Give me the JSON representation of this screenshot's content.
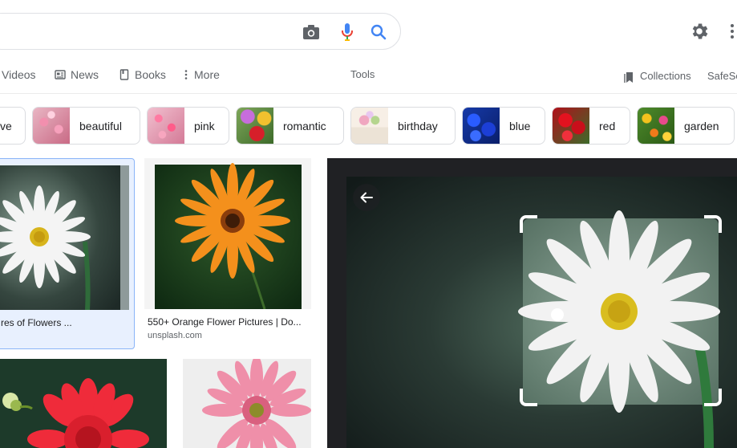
{
  "search": {
    "icons": [
      "camera-icon",
      "mic-icon",
      "search-icon"
    ]
  },
  "tabs": {
    "videos": "Videos",
    "news": "News",
    "books": "Books",
    "more": "More",
    "tools": "Tools",
    "collections": "Collections",
    "safesearch": "SafeSe"
  },
  "chips": [
    {
      "label": "ve"
    },
    {
      "label": "beautiful"
    },
    {
      "label": "pink"
    },
    {
      "label": "romantic"
    },
    {
      "label": "birthday"
    },
    {
      "label": "blue"
    },
    {
      "label": "red"
    },
    {
      "label": "garden"
    }
  ],
  "results": [
    {
      "caption": "res of Flowers ...",
      "source": ""
    },
    {
      "caption": "550+ Orange Flower Pictures | Do...",
      "source": "unsplash.com"
    }
  ],
  "colors": {
    "accent_blue": "#1a73e8",
    "selected_bg": "#e8f0fe",
    "preview_bg": "#202124"
  }
}
